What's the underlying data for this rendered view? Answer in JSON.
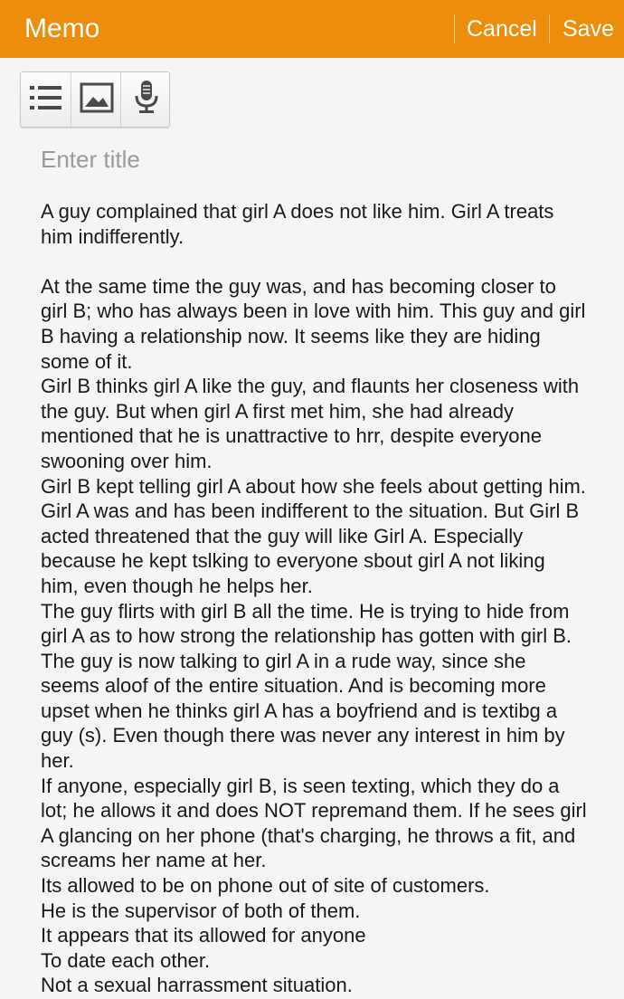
{
  "header": {
    "title": "Memo",
    "cancel_label": "Cancel",
    "save_label": "Save",
    "background_color": "#ec8d0b"
  },
  "toolbar": {
    "tools": [
      {
        "icon": "list-icon"
      },
      {
        "icon": "image-icon"
      },
      {
        "icon": "microphone-icon"
      }
    ]
  },
  "memo": {
    "title_value": "",
    "title_placeholder": "Enter title",
    "body": "A guy complained that girl A does not like him. Girl A treats him indifferently.\n\nAt the same time the guy was, and has becoming closer to girl B; who has always been in love with him. This guy and girl B having a relationship now. It seems like they are hiding some of it.\nGirl B thinks girl A like the guy, and flaunts her closeness with the guy. But when girl A first met him, she had already mentioned that he is unattractive to hrr, despite everyone swooning over him.\nGirl B kept telling girl A about how she feels about getting him. Girl A was and has been indifferent to the situation. But Girl B acted threatened that the guy will like Girl A. Especially because he kept tslking to everyone sbout girl A not liking him, even though he helps her.\nThe guy flirts with girl B all the time. He is trying to hide from girl A as to how strong the relationship has gotten with girl B. The guy is now talking to girl A in a rude way, since she seems aloof of the entire situation. And is becoming more upset when he thinks girl A has a boyfriend and is textibg a guy (s). Even though there was never any interest in him by her.\nIf anyone, especially girl B, is seen texting, which they do a lot; he allows it and does NOT repremand them. If he sees girl A glancing on her phone (that's charging, he throws a fit, and screams her name at her.\nIts allowed to be on phone out of site of customers.\nHe is the supervisor of both of them.\nIt appears that its allowed for anyone\nTo date each other.\nNot a sexual harrassment situation."
  }
}
